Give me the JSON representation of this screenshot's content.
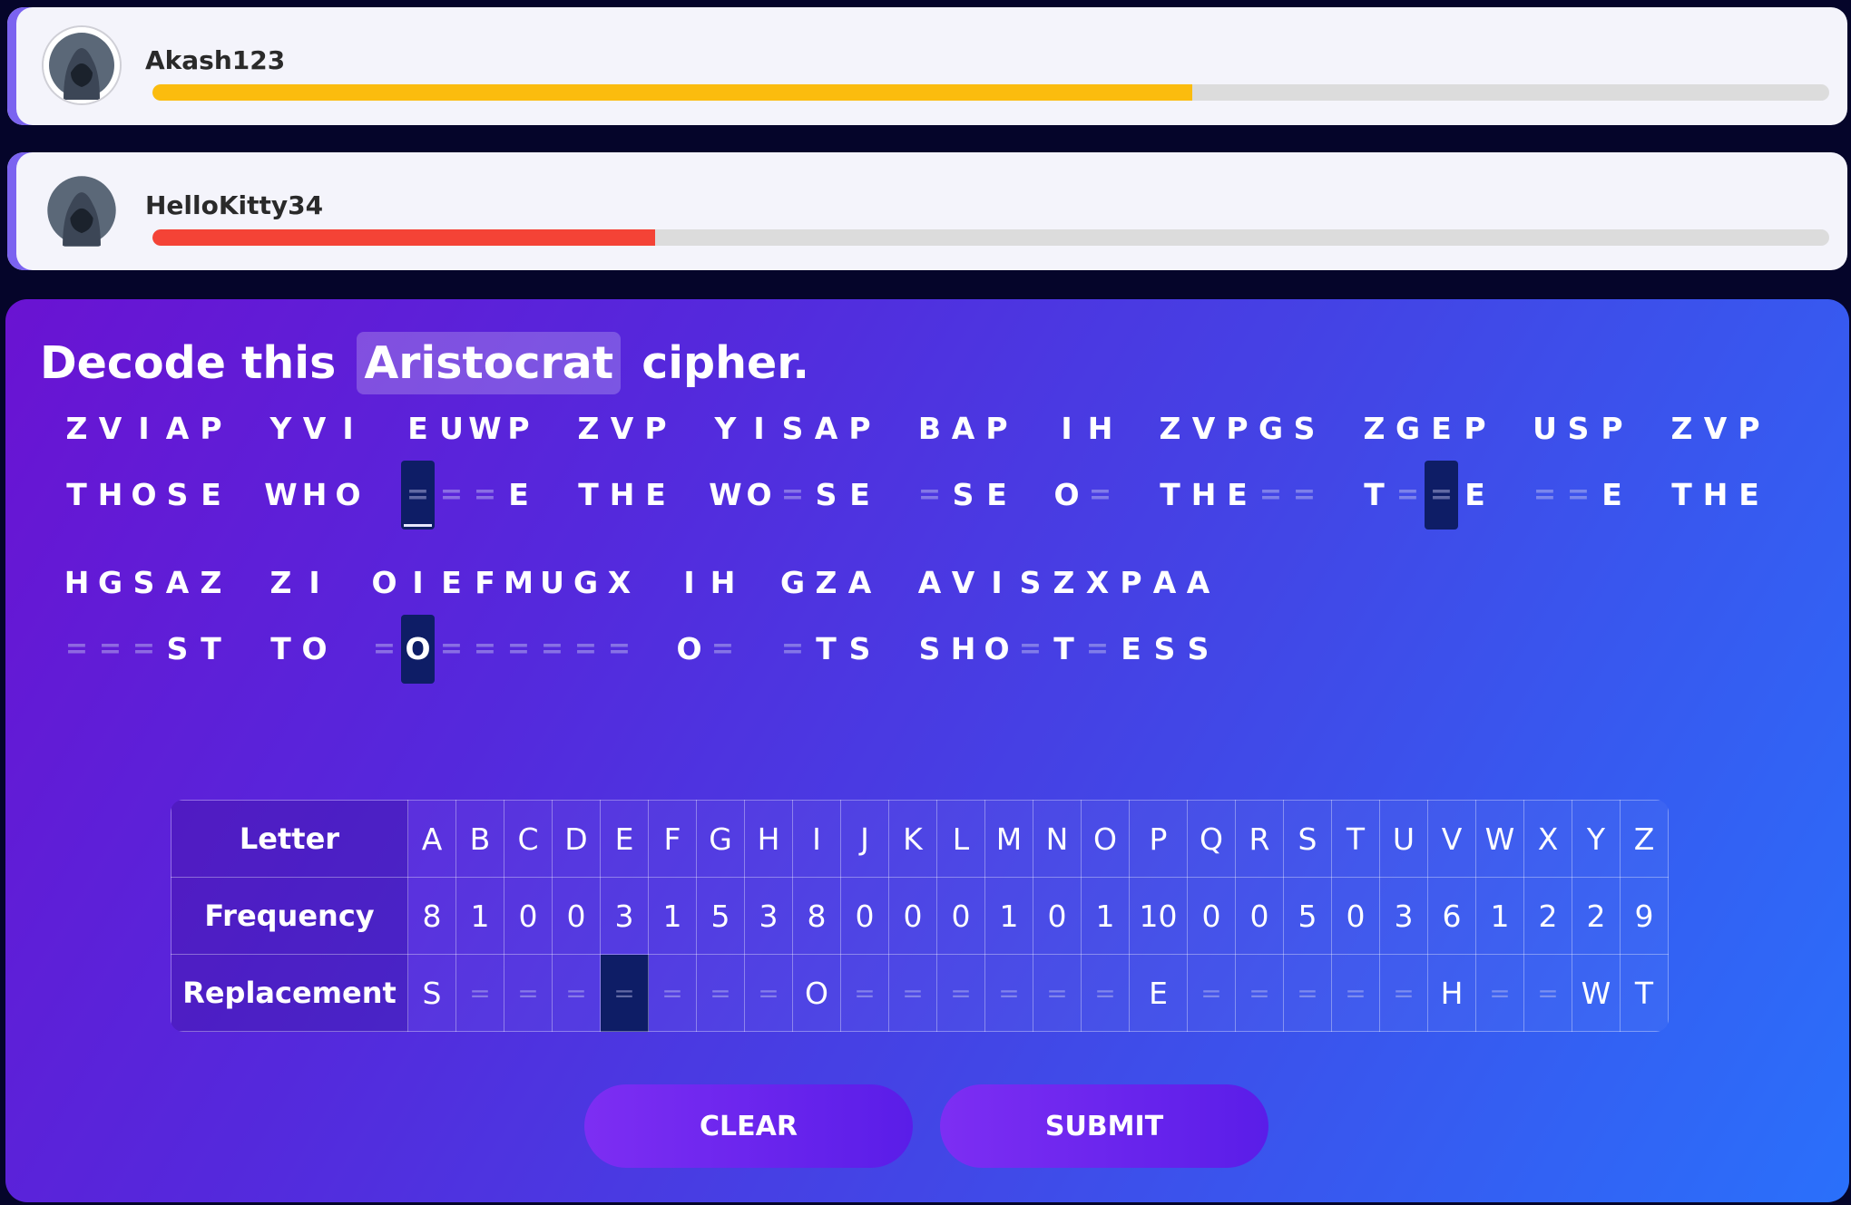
{
  "players": [
    {
      "name": "Akash123",
      "progress": 0.62,
      "color": "#fbbc0e",
      "avatar": "hooded-user-avatar"
    },
    {
      "name": "HelloKitty34",
      "progress": 0.3,
      "color": "#f44336",
      "avatar": "hooded-user-avatar"
    }
  ],
  "prompt": {
    "before": "Decode this ",
    "cipher_type": "Aristocrat",
    "after": " cipher."
  },
  "puzzle": {
    "lines": [
      {
        "words": [
          {
            "cipher": "ZVIAP",
            "plain": "THOSE"
          },
          {
            "cipher": "YVI",
            "plain": "WHO"
          },
          {
            "cipher": "EUWP",
            "plain": "___E"
          },
          {
            "cipher": "ZVP",
            "plain": "THE"
          },
          {
            "cipher": "YISAP",
            "plain": "WO_SE"
          },
          {
            "cipher": "BAP",
            "plain": "_SE"
          },
          {
            "cipher": "IH",
            "plain": "O_"
          },
          {
            "cipher": "ZVPGS",
            "plain": "THE__"
          },
          {
            "cipher": "ZGEP",
            "plain": "T__E"
          },
          {
            "cipher": "USP",
            "plain": "__E"
          },
          {
            "cipher": "ZVP",
            "plain": "THE"
          }
        ]
      },
      {
        "words": [
          {
            "cipher": "HGSAZ",
            "plain": "___ST"
          },
          {
            "cipher": "ZI",
            "plain": "TO"
          },
          {
            "cipher": "OIEFMUGX",
            "plain": "_O______"
          },
          {
            "cipher": "IH",
            "plain": "O_"
          },
          {
            "cipher": "GZA",
            "plain": "_TS"
          },
          {
            "cipher": "AVISZXPAA",
            "plain": "SHO_T_ESS"
          }
        ]
      }
    ]
  },
  "table": {
    "row_labels": [
      "Letter",
      "Frequency",
      "Replacement"
    ],
    "letters": [
      "A",
      "B",
      "C",
      "D",
      "E",
      "F",
      "G",
      "H",
      "I",
      "J",
      "K",
      "L",
      "M",
      "N",
      "O",
      "P",
      "Q",
      "R",
      "S",
      "T",
      "U",
      "V",
      "W",
      "X",
      "Y",
      "Z"
    ],
    "frequencies": [
      "8",
      "1",
      "0",
      "0",
      "3",
      "1",
      "5",
      "3",
      "8",
      "0",
      "0",
      "0",
      "1",
      "0",
      "1",
      "10",
      "0",
      "0",
      "5",
      "0",
      "3",
      "6",
      "1",
      "2",
      "2",
      "9"
    ],
    "replacements": [
      "S",
      "",
      "",
      "",
      "",
      "",
      "",
      "",
      "O",
      "",
      "",
      "",
      "",
      "",
      "",
      "E",
      "",
      "",
      "",
      "",
      "",
      "H",
      "",
      "",
      "W",
      "T"
    ],
    "selected_letter": "E",
    "blank_glyph": "="
  },
  "buttons": {
    "clear": "CLEAR",
    "submit": "SUBMIT"
  },
  "colors": {
    "accent": "#7b63f0",
    "selected": "#0e1d66",
    "button": "#6a24ee"
  }
}
